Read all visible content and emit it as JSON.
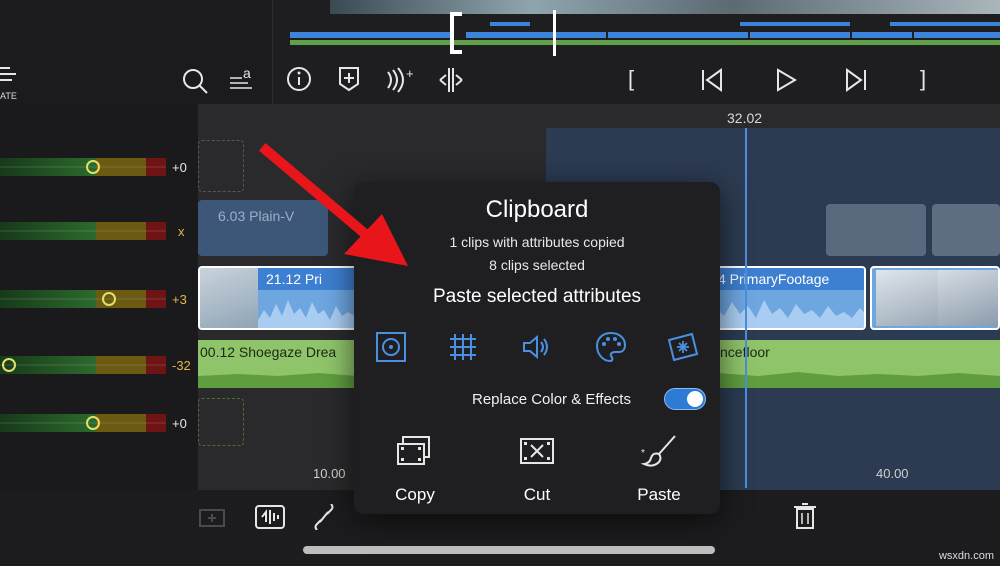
{
  "timeline": {
    "timecode": "32.02",
    "ruler_marks": [
      "10.00",
      "40.00"
    ],
    "tracks": [
      {
        "volume": "+0"
      },
      {
        "volume": "x"
      },
      {
        "volume": "+3"
      },
      {
        "volume": "-32"
      },
      {
        "volume": "+0"
      }
    ],
    "clips": {
      "plain": "6.03  Plain-V",
      "primary_left": "21.12  Pri",
      "primary_right": "4  PrimaryFootage",
      "audio_left": "00.12  Shoegaze Drea",
      "audio_right": "ncefloor"
    }
  },
  "left_panel": {
    "label_partial": "ATE"
  },
  "clipboard": {
    "title": "Clipboard",
    "copied_line": "1 clips with attributes copied",
    "selected_line": "8 clips selected",
    "heading": "Paste selected attributes",
    "replace_label": "Replace Color & Effects",
    "replace_on": true,
    "actions": {
      "copy": "Copy",
      "cut": "Cut",
      "paste": "Paste"
    }
  },
  "colors": {
    "accent": "#4a90e2",
    "arrow": "#e8161b",
    "selection": "#2c3b52"
  },
  "watermark": "wsxdn.com"
}
